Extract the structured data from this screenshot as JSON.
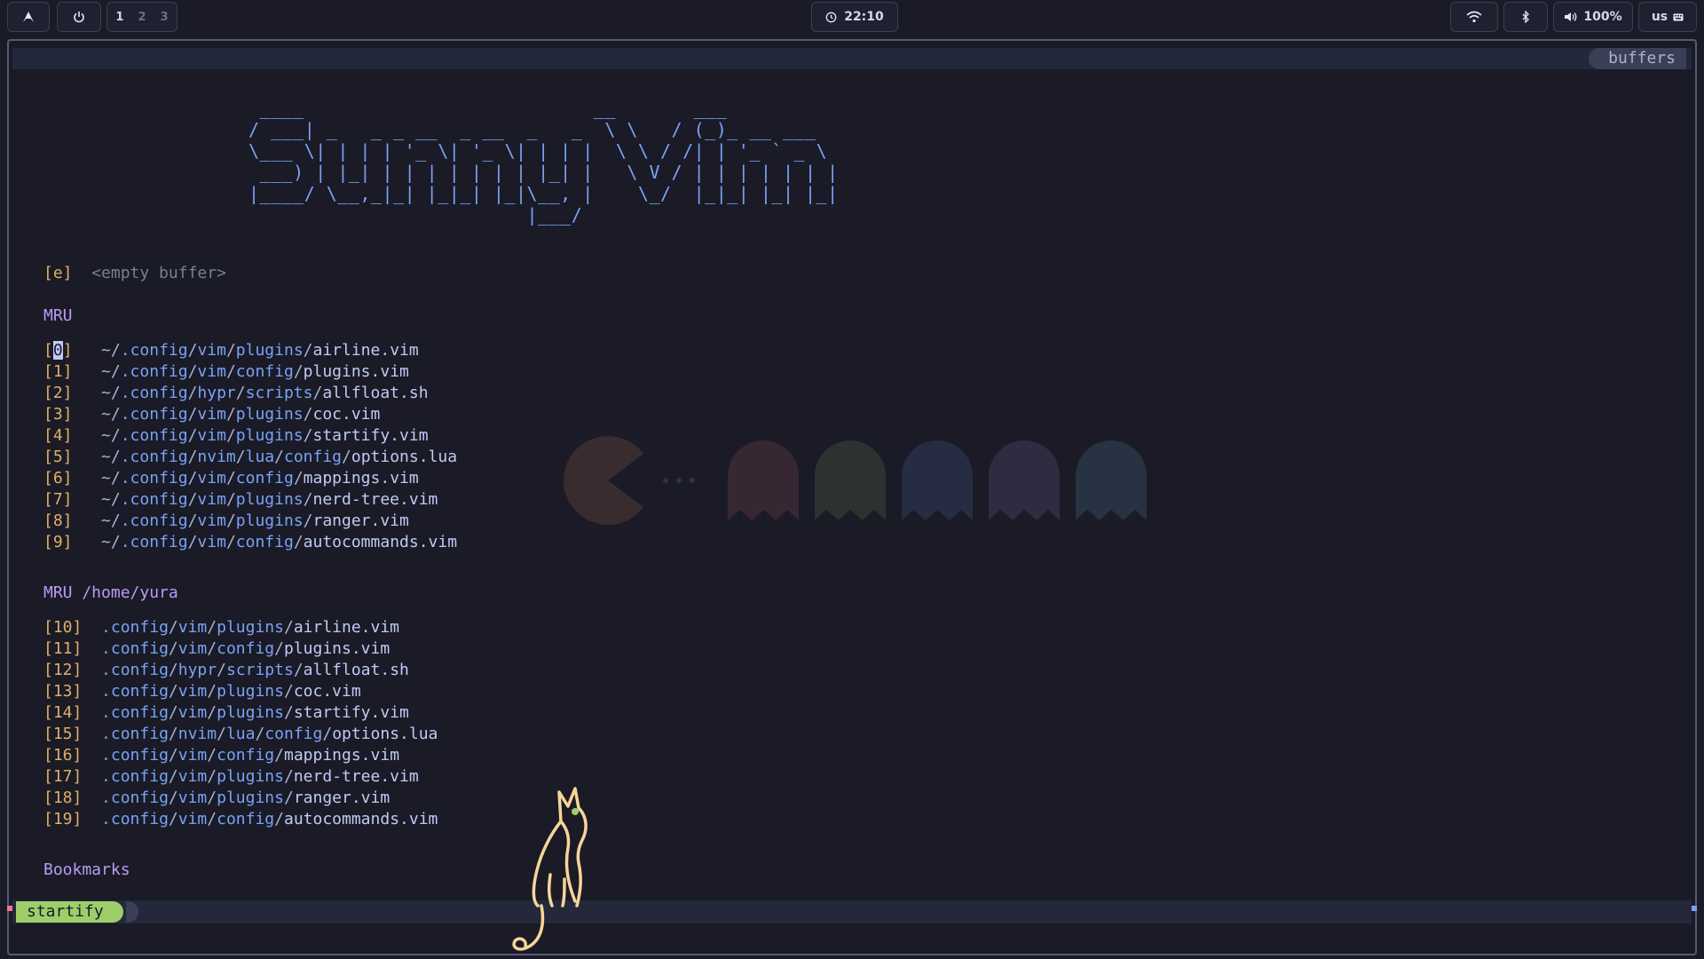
{
  "topbar": {
    "workspaces": [
      "1",
      "2",
      "3"
    ],
    "clock": "22:10",
    "volume": "100%",
    "keyboard_layout": "us",
    "icons": {
      "launcher": "arch-icon",
      "power": "power-icon",
      "clock": "clock-icon",
      "wifi": "wifi-icon",
      "bluetooth": "bluetooth-icon",
      "volume": "volume-icon",
      "keyboard": "keyboard-icon"
    }
  },
  "tabline": {
    "label": "buffers"
  },
  "banner": " ____                          __       ___\n/ ___| _   _ _ __  _ __  _   _  \\ \\   / (_)_ __ ___\n\\___ \\| | | | '_ \\| '_ \\| | | |  \\ \\ / /| | '_ ` _ \\\n ___) | |_| | | | | | | | |_| |   \\ V / | | | | | | |\n|____/ \\__,_|_| |_|_| |_|\\__, |    \\_/  |_|_| |_| |_|\n                         |___/",
  "empty_entry": {
    "key": "[e]",
    "label": "<empty buffer>"
  },
  "sections": {
    "mru": "MRU",
    "mru_cwd": "MRU /home/yura",
    "bookmarks": "Bookmarks"
  },
  "mru": [
    {
      "idx": "[0]",
      "prefix": "~/",
      "dirs": [
        ".config",
        "vim",
        "plugins"
      ],
      "file": "airline.vim"
    },
    {
      "idx": "[1]",
      "prefix": "~/",
      "dirs": [
        ".config",
        "vim",
        "config"
      ],
      "file": "plugins.vim"
    },
    {
      "idx": "[2]",
      "prefix": "~/",
      "dirs": [
        ".config",
        "hypr",
        "scripts"
      ],
      "file": "allfloat.sh"
    },
    {
      "idx": "[3]",
      "prefix": "~/",
      "dirs": [
        ".config",
        "vim",
        "plugins"
      ],
      "file": "coc.vim"
    },
    {
      "idx": "[4]",
      "prefix": "~/",
      "dirs": [
        ".config",
        "vim",
        "plugins"
      ],
      "file": "startify.vim"
    },
    {
      "idx": "[5]",
      "prefix": "~/",
      "dirs": [
        ".config",
        "nvim",
        "lua",
        "config"
      ],
      "file": "options.lua"
    },
    {
      "idx": "[6]",
      "prefix": "~/",
      "dirs": [
        ".config",
        "vim",
        "config"
      ],
      "file": "mappings.vim"
    },
    {
      "idx": "[7]",
      "prefix": "~/",
      "dirs": [
        ".config",
        "vim",
        "plugins"
      ],
      "file": "nerd-tree.vim"
    },
    {
      "idx": "[8]",
      "prefix": "~/",
      "dirs": [
        ".config",
        "vim",
        "plugins"
      ],
      "file": "ranger.vim"
    },
    {
      "idx": "[9]",
      "prefix": "~/",
      "dirs": [
        ".config",
        "vim",
        "config"
      ],
      "file": "autocommands.vim"
    }
  ],
  "mru_cwd": [
    {
      "idx": "[10]",
      "prefix": "",
      "dirs": [
        ".config",
        "vim",
        "plugins"
      ],
      "file": "airline.vim"
    },
    {
      "idx": "[11]",
      "prefix": "",
      "dirs": [
        ".config",
        "vim",
        "config"
      ],
      "file": "plugins.vim"
    },
    {
      "idx": "[12]",
      "prefix": "",
      "dirs": [
        ".config",
        "hypr",
        "scripts"
      ],
      "file": "allfloat.sh"
    },
    {
      "idx": "[13]",
      "prefix": "",
      "dirs": [
        ".config",
        "vim",
        "plugins"
      ],
      "file": "coc.vim"
    },
    {
      "idx": "[14]",
      "prefix": "",
      "dirs": [
        ".config",
        "vim",
        "plugins"
      ],
      "file": "startify.vim"
    },
    {
      "idx": "[15]",
      "prefix": "",
      "dirs": [
        ".config",
        "nvim",
        "lua",
        "config"
      ],
      "file": "options.lua"
    },
    {
      "idx": "[16]",
      "prefix": "",
      "dirs": [
        ".config",
        "vim",
        "config"
      ],
      "file": "mappings.vim"
    },
    {
      "idx": "[17]",
      "prefix": "",
      "dirs": [
        ".config",
        "vim",
        "plugins"
      ],
      "file": "nerd-tree.vim"
    },
    {
      "idx": "[18]",
      "prefix": "",
      "dirs": [
        ".config",
        "vim",
        "plugins"
      ],
      "file": "ranger.vim"
    },
    {
      "idx": "[19]",
      "prefix": "",
      "dirs": [
        ".config",
        "vim",
        "config"
      ],
      "file": "autocommands.vim"
    }
  ],
  "statusline": {
    "mode": "startify"
  },
  "colors": {
    "background": "#1a1b26",
    "index": "#e0af68",
    "directory": "#7aa2f7",
    "section": "#bb9af7",
    "mode": "#9ece6a",
    "cat": "#f6d59a"
  }
}
